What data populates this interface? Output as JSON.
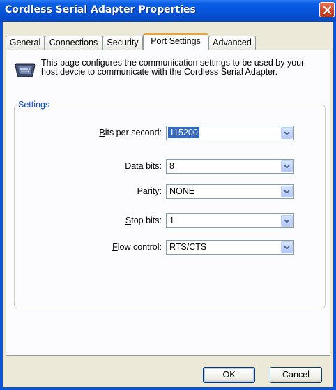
{
  "window": {
    "title": "Cordless Serial Adapter Properties"
  },
  "tabs": [
    {
      "label": "General",
      "active": false
    },
    {
      "label": "Connections",
      "active": false
    },
    {
      "label": "Security",
      "active": false
    },
    {
      "label": "Port Settings",
      "active": true
    },
    {
      "label": "Advanced",
      "active": false
    }
  ],
  "panel": {
    "intro": "This page configures the communication settings to be used by your host devcie to communicate with the Cordless Serial Adapter.",
    "icon": "serial-port-icon",
    "group_label": "Settings"
  },
  "settings": {
    "bits_per_second": {
      "label_pre": "",
      "label_accel": "B",
      "label_post": "its per second:",
      "value": "115200"
    },
    "data_bits": {
      "label_pre": "",
      "label_accel": "D",
      "label_post": "ata bits:",
      "value": "8"
    },
    "parity": {
      "label_pre": "",
      "label_accel": "P",
      "label_post": "arity:",
      "value": "NONE"
    },
    "stop_bits": {
      "label_pre": "",
      "label_accel": "S",
      "label_post": "top bits:",
      "value": "1"
    },
    "flow_control": {
      "label_pre": "",
      "label_accel": "F",
      "label_post": "low control:",
      "value": "RTS/CTS"
    }
  },
  "buttons": {
    "ok": "OK",
    "cancel": "Cancel"
  },
  "colors": {
    "titlebar": "#0a55d8",
    "dialog_bg": "#ece9d8",
    "panel_bg": "#fcfcfe",
    "selection": "#316ac5",
    "group_label": "#0046d5"
  }
}
